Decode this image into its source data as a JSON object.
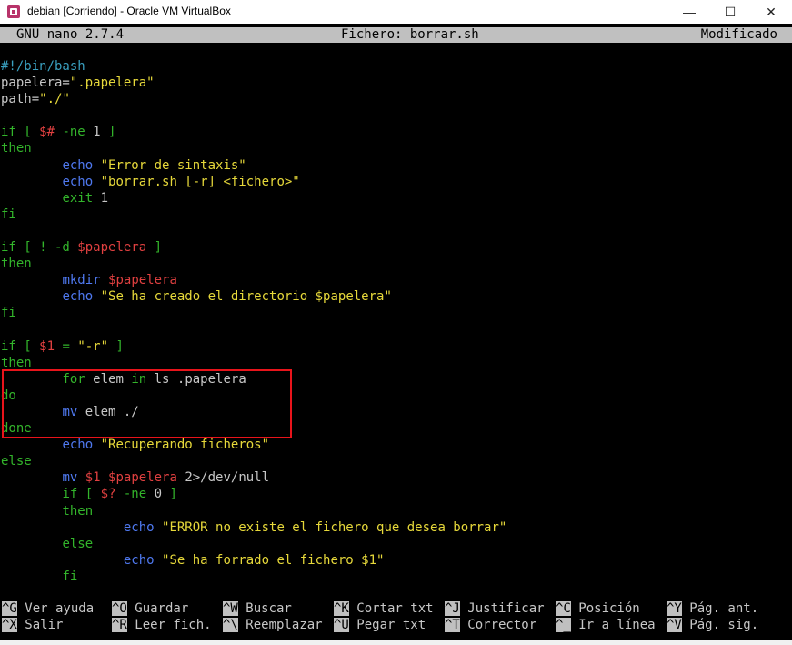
{
  "window": {
    "title": "debian [Corriendo] - Oracle VM VirtualBox",
    "minimize_glyph": "—",
    "maximize_glyph": "☐",
    "close_glyph": "✕"
  },
  "nano": {
    "version": "GNU nano 2.7.4",
    "file": "Fichero: borrar.sh",
    "status": "Modificado"
  },
  "code_lines": [
    [
      {
        "t": "#!/bin/bash",
        "c": "cc"
      }
    ],
    [
      {
        "t": "papelera=",
        "c": "cw"
      },
      {
        "t": "\".papelera\"",
        "c": "cy"
      }
    ],
    [
      {
        "t": "path=",
        "c": "cw"
      },
      {
        "t": "\"./\"",
        "c": "cy"
      }
    ],
    [],
    [
      {
        "t": "if [ ",
        "c": "cg"
      },
      {
        "t": "$#",
        "c": "cr"
      },
      {
        "t": " -ne ",
        "c": "cg"
      },
      {
        "t": "1",
        "c": "cw"
      },
      {
        "t": " ]",
        "c": "cg"
      }
    ],
    [
      {
        "t": "then",
        "c": "cg"
      }
    ],
    [
      {
        "t": "        ",
        "c": "cw"
      },
      {
        "t": "echo",
        "c": "cb"
      },
      {
        "t": " ",
        "c": "cw"
      },
      {
        "t": "\"Error de sintaxis\"",
        "c": "cy"
      }
    ],
    [
      {
        "t": "        ",
        "c": "cw"
      },
      {
        "t": "echo",
        "c": "cb"
      },
      {
        "t": " ",
        "c": "cw"
      },
      {
        "t": "\"borrar.sh [-r] <fichero>\"",
        "c": "cy"
      }
    ],
    [
      {
        "t": "        ",
        "c": "cw"
      },
      {
        "t": "exit",
        "c": "cg"
      },
      {
        "t": " 1",
        "c": "cw"
      }
    ],
    [
      {
        "t": "fi",
        "c": "cg"
      }
    ],
    [],
    [
      {
        "t": "if [ ! -d ",
        "c": "cg"
      },
      {
        "t": "$papelera",
        "c": "cr"
      },
      {
        "t": " ]",
        "c": "cg"
      }
    ],
    [
      {
        "t": "then",
        "c": "cg"
      }
    ],
    [
      {
        "t": "        ",
        "c": "cw"
      },
      {
        "t": "mkdir",
        "c": "cb"
      },
      {
        "t": " ",
        "c": "cw"
      },
      {
        "t": "$papelera",
        "c": "cr"
      }
    ],
    [
      {
        "t": "        ",
        "c": "cw"
      },
      {
        "t": "echo",
        "c": "cb"
      },
      {
        "t": " ",
        "c": "cw"
      },
      {
        "t": "\"Se ha creado el directorio $papelera\"",
        "c": "cy"
      }
    ],
    [
      {
        "t": "fi",
        "c": "cg"
      }
    ],
    [],
    [
      {
        "t": "if [ ",
        "c": "cg"
      },
      {
        "t": "$1",
        "c": "cr"
      },
      {
        "t": " = ",
        "c": "cg"
      },
      {
        "t": "\"-r\"",
        "c": "cy"
      },
      {
        "t": " ]",
        "c": "cg"
      }
    ],
    [
      {
        "t": "then",
        "c": "cg"
      }
    ],
    [
      {
        "t": "        ",
        "c": "cw"
      },
      {
        "t": "for",
        "c": "cg"
      },
      {
        "t": " elem ",
        "c": "cw"
      },
      {
        "t": "in",
        "c": "cg"
      },
      {
        "t": " ls .papelera",
        "c": "cw"
      }
    ],
    [
      {
        "t": "do",
        "c": "cg"
      }
    ],
    [
      {
        "t": "        ",
        "c": "cw"
      },
      {
        "t": "mv",
        "c": "cb"
      },
      {
        "t": " elem ./",
        "c": "cw"
      }
    ],
    [
      {
        "t": "done",
        "c": "cg"
      }
    ],
    [
      {
        "t": "        ",
        "c": "cw"
      },
      {
        "t": "echo",
        "c": "cb"
      },
      {
        "t": " ",
        "c": "cw"
      },
      {
        "t": "\"Recuperando ficheros\"",
        "c": "cy"
      }
    ],
    [
      {
        "t": "else",
        "c": "cg"
      }
    ],
    [
      {
        "t": "        ",
        "c": "cw"
      },
      {
        "t": "mv",
        "c": "cb"
      },
      {
        "t": " ",
        "c": "cw"
      },
      {
        "t": "$1",
        "c": "cr"
      },
      {
        "t": " ",
        "c": "cw"
      },
      {
        "t": "$papelera",
        "c": "cr"
      },
      {
        "t": " 2>/dev/null",
        "c": "cw"
      }
    ],
    [
      {
        "t": "        ",
        "c": "cw"
      },
      {
        "t": "if [ ",
        "c": "cg"
      },
      {
        "t": "$?",
        "c": "cr"
      },
      {
        "t": " -ne ",
        "c": "cg"
      },
      {
        "t": "0",
        "c": "cw"
      },
      {
        "t": " ]",
        "c": "cg"
      }
    ],
    [
      {
        "t": "        ",
        "c": "cw"
      },
      {
        "t": "then",
        "c": "cg"
      }
    ],
    [
      {
        "t": "                ",
        "c": "cw"
      },
      {
        "t": "echo",
        "c": "cb"
      },
      {
        "t": " ",
        "c": "cw"
      },
      {
        "t": "\"ERROR no existe el fichero que desea borrar\"",
        "c": "cy"
      }
    ],
    [
      {
        "t": "        ",
        "c": "cw"
      },
      {
        "t": "else",
        "c": "cg"
      }
    ],
    [
      {
        "t": "                ",
        "c": "cw"
      },
      {
        "t": "echo",
        "c": "cb"
      },
      {
        "t": " ",
        "c": "cw"
      },
      {
        "t": "\"Se ha forrado el fichero $1\"",
        "c": "cy"
      }
    ],
    [
      {
        "t": "        ",
        "c": "cw"
      },
      {
        "t": "fi",
        "c": "cg"
      }
    ]
  ],
  "shortcuts": [
    [
      {
        "key": "^G",
        "label": " Ver ayuda"
      },
      {
        "key": "^O",
        "label": " Guardar"
      },
      {
        "key": "^W",
        "label": " Buscar"
      },
      {
        "key": "^K",
        "label": " Cortar txt"
      },
      {
        "key": "^J",
        "label": " Justificar"
      },
      {
        "key": "^C",
        "label": " Posición"
      },
      {
        "key": "^Y",
        "label": " Pág. ant."
      }
    ],
    [
      {
        "key": "^X",
        "label": " Salir"
      },
      {
        "key": "^R",
        "label": " Leer fich."
      },
      {
        "key": "^\\",
        "label": " Reemplazar"
      },
      {
        "key": "^U",
        "label": " Pegar txt"
      },
      {
        "key": "^T",
        "label": " Corrector"
      },
      {
        "key": "^_",
        "label": " Ir a línea"
      },
      {
        "key": "^V",
        "label": " Pág. sig."
      }
    ]
  ],
  "colors": {
    "highlight_box": "#e8141b",
    "header_bg": "#c0c0c0",
    "terminal_bg": "#000000"
  }
}
